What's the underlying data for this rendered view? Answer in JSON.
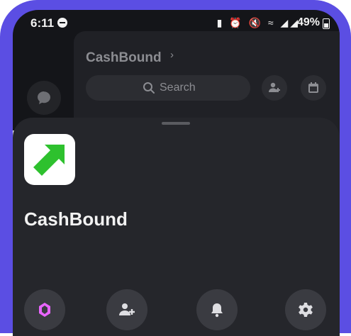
{
  "status_bar": {
    "time": "6:11",
    "icons": "▮ ⏰ 🔇 ≈ ◢◢",
    "battery": "49%"
  },
  "background": {
    "server_title": "CashBound",
    "search_label": "Search",
    "icons": [
      "chat-bubble-icon",
      "add-member-icon",
      "calendar-icon"
    ]
  },
  "sheet": {
    "app_name": "CashBound",
    "actions": [
      "boost-icon",
      "invite-icon",
      "notifications-icon",
      "settings-icon"
    ]
  },
  "colors": {
    "frame": "#5b4ee3",
    "background": "#141519",
    "sheet": "#25262b",
    "brand_green": "#2ec12e",
    "boost_pink": "#e965ff"
  }
}
